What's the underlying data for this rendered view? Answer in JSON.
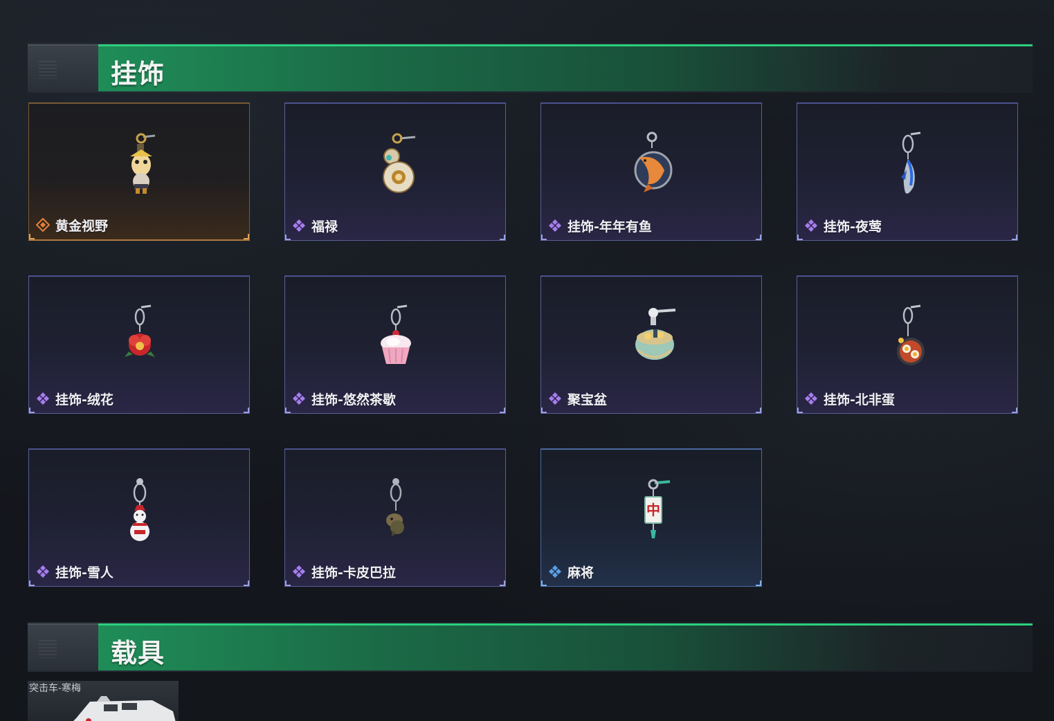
{
  "sections": {
    "pendants": {
      "title": "挂饰"
    },
    "vehicles": {
      "title": "载具"
    }
  },
  "items": [
    {
      "name": "黄金视野",
      "rarity": "gold",
      "icon": "golden-knight-pendant-icon"
    },
    {
      "name": "福禄",
      "rarity": "purple",
      "icon": "gourd-pendant-icon"
    },
    {
      "name": "挂饰-年年有鱼",
      "rarity": "purple",
      "icon": "fish-pendant-icon"
    },
    {
      "name": "挂饰-夜莺",
      "rarity": "purple",
      "icon": "nightingale-feather-pendant-icon"
    },
    {
      "name": "挂饰-绒花",
      "rarity": "purple",
      "icon": "velvet-flower-pendant-icon"
    },
    {
      "name": "挂饰-悠然茶歇",
      "rarity": "purple",
      "icon": "cupcake-pendant-icon"
    },
    {
      "name": "聚宝盆",
      "rarity": "purple",
      "icon": "treasure-bowl-pendant-icon"
    },
    {
      "name": "挂饰-北非蛋",
      "rarity": "purple",
      "icon": "shakshuka-pan-pendant-icon"
    },
    {
      "name": "挂饰-雪人",
      "rarity": "purple",
      "icon": "snowman-pendant-icon"
    },
    {
      "name": "挂饰-卡皮巴拉",
      "rarity": "purple",
      "icon": "capybara-pendant-icon"
    },
    {
      "name": "麻将",
      "rarity": "blue",
      "icon": "mahjong-tile-pendant-icon"
    }
  ],
  "vehicle": {
    "name": "突击车-寒梅"
  },
  "mahjong_char": "中",
  "colors": {
    "gold": "#e8803a",
    "purple": "#a77df0",
    "blue": "#5aa0e8",
    "accent_green": "#2bd07e"
  }
}
